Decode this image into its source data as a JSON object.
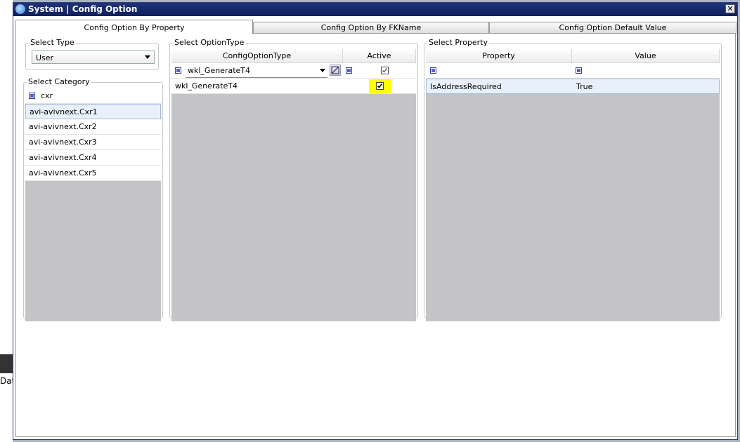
{
  "window": {
    "title": "System | Config Option",
    "close_glyph": "✕"
  },
  "tabs": [
    {
      "label": "Config Option By Property",
      "active": true
    },
    {
      "label": "Config Option By FKName",
      "active": false
    },
    {
      "label": "Config Option Default Value",
      "active": false
    }
  ],
  "select_type": {
    "legend": "Select Type",
    "value": "User"
  },
  "select_category": {
    "legend": "Select Category",
    "filter_text": "cxr",
    "items": [
      "avi-avivnext.Cxr1",
      "avi-avivnext.Cxr2",
      "avi-avivnext.Cxr3",
      "avi-avivnext.Cxr4",
      "avi-avivnext.Cxr5"
    ],
    "selected_index": 0
  },
  "select_option_type": {
    "legend": "Select OptionType",
    "columns": [
      "ConfigOptionType",
      "Active"
    ],
    "filter_value": "wkl_GenerateT4",
    "rows": [
      {
        "type": "wkl_GenerateT4",
        "active": true
      }
    ]
  },
  "select_property": {
    "legend": "Select Property",
    "columns": [
      "Property",
      "Value"
    ],
    "rows": [
      {
        "property": "IsAddressRequired",
        "value": "True"
      }
    ]
  },
  "background": {
    "partial_text": "Dat"
  },
  "colors": {
    "highlight": "#ffff00",
    "title_bar": "#14246a",
    "selection": "#e8f1fb"
  }
}
